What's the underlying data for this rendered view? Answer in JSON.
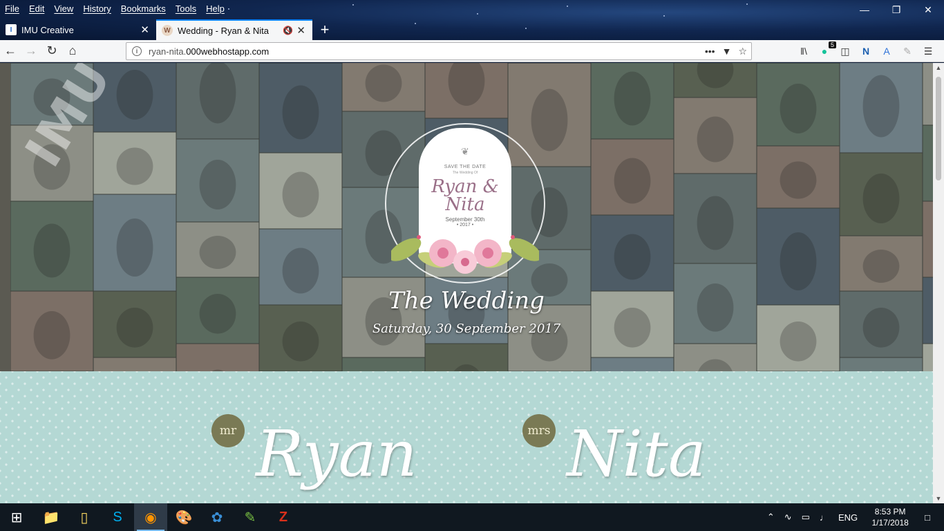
{
  "menu": [
    "File",
    "Edit",
    "View",
    "History",
    "Bookmarks",
    "Tools",
    "Help"
  ],
  "tabs": [
    {
      "title": "IMU Creative",
      "favicon": "I"
    },
    {
      "title": "Wedding - Ryan & Nita",
      "favicon": "W"
    }
  ],
  "url": {
    "prefix": "ryan-nita.",
    "domain": "000webhostapp.com"
  },
  "extensions": {
    "badge_count": "5"
  },
  "page": {
    "watermark": "IMU Creative",
    "crest": {
      "save_the_date": "SAVE THE DATE",
      "sub": "The Wedding Of",
      "names": "Ryan & Nita",
      "date": "September 30th",
      "year": "• 2017 •"
    },
    "title": "The Wedding",
    "date_line": "Saturday, 30 September 2017",
    "groom": {
      "prefix": "mr",
      "name": "Ryan"
    },
    "bride": {
      "prefix": "mrs",
      "name": "Nita"
    }
  },
  "taskbar": {
    "language": "ENG",
    "time": "8:53 PM",
    "date": "1/17/2018"
  },
  "colors": {
    "active_tab_border": "#0a84ff",
    "section_bg": "#b4d8d4",
    "pill_bg": "#7a7a55"
  }
}
